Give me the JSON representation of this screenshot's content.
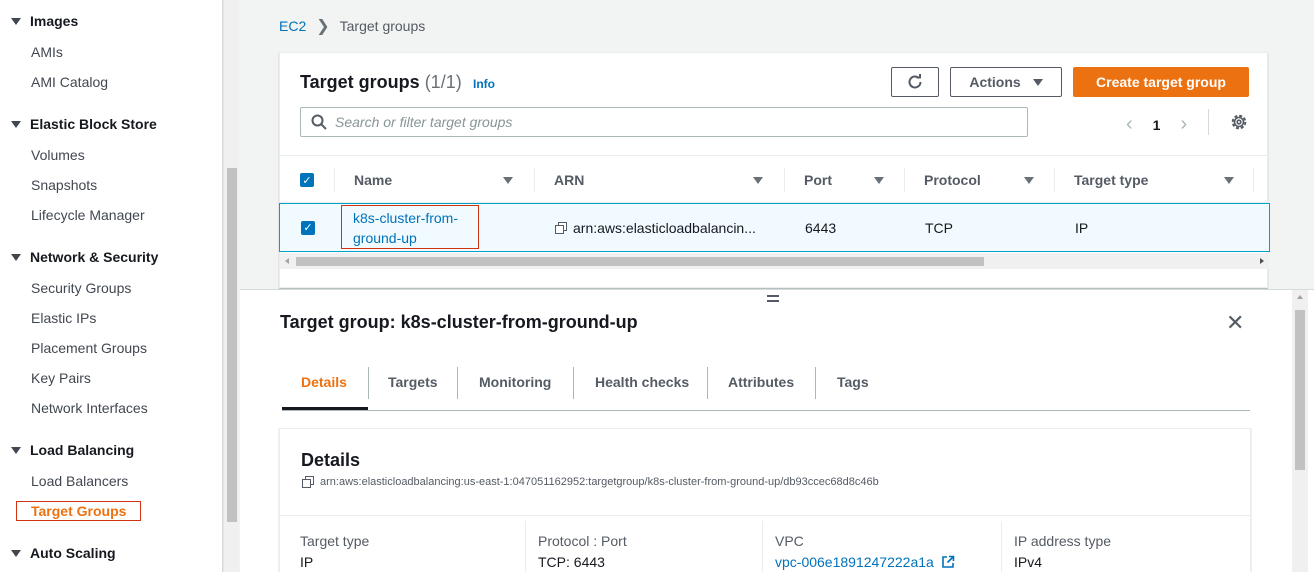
{
  "sidebar": {
    "sections": [
      {
        "label": "Images",
        "items": [
          "AMIs",
          "AMI Catalog"
        ]
      },
      {
        "label": "Elastic Block Store",
        "items": [
          "Volumes",
          "Snapshots",
          "Lifecycle Manager"
        ]
      },
      {
        "label": "Network & Security",
        "items": [
          "Security Groups",
          "Elastic IPs",
          "Placement Groups",
          "Key Pairs",
          "Network Interfaces"
        ]
      },
      {
        "label": "Load Balancing",
        "items": [
          "Load Balancers",
          "Target Groups"
        ]
      },
      {
        "label": "Auto Scaling",
        "items": []
      }
    ],
    "active_item": "Target Groups"
  },
  "breadcrumb": {
    "root": "EC2",
    "current": "Target groups"
  },
  "panel": {
    "title": "Target groups",
    "count": "(1/1)",
    "info": "Info",
    "actions_label": "Actions",
    "create_label": "Create target group",
    "search_placeholder": "Search or filter target groups",
    "page": "1"
  },
  "table": {
    "columns": [
      "Name",
      "ARN",
      "Port",
      "Protocol",
      "Target type"
    ],
    "rows": [
      {
        "name": "k8s-cluster-from-ground-up",
        "arn": "arn:aws:elasticloadbalancin...",
        "port": "6443",
        "protocol": "TCP",
        "target_type": "IP",
        "selected": true
      }
    ]
  },
  "split": {
    "title": "Target group: k8s-cluster-from-ground-up",
    "tabs": [
      "Details",
      "Targets",
      "Monitoring",
      "Health checks",
      "Attributes",
      "Tags"
    ],
    "active_tab": "Details"
  },
  "details": {
    "title": "Details",
    "arn": "arn:aws:elasticloadbalancing:us-east-1:047051162952:targetgroup/k8s-cluster-from-ground-up/db93ccec68d8c46b",
    "fields": [
      {
        "label": "Target type",
        "value": "IP"
      },
      {
        "label": "Protocol : Port",
        "value": "TCP: 6443"
      },
      {
        "label": "VPC",
        "value": "vpc-006e1891247222a1a"
      },
      {
        "label": "IP address type",
        "value": "IPv4"
      }
    ]
  },
  "colors": {
    "accent": "#ec7211",
    "link": "#0073bb",
    "highlight": "#d13212"
  }
}
